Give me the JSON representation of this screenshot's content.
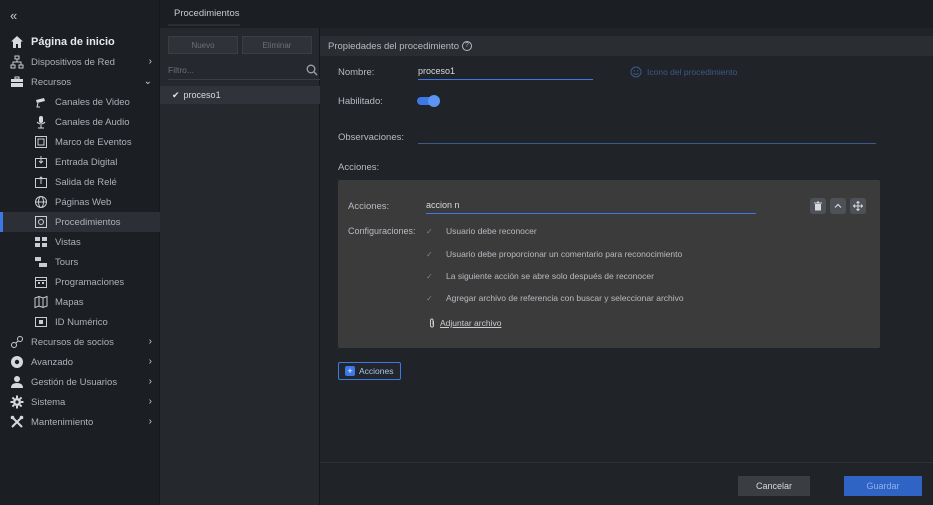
{
  "sidebar": {
    "collapse_icon": "double-chevron-left-icon",
    "items": [
      {
        "label": "Página de inicio",
        "icon": "home-icon"
      },
      {
        "label": "Dispositivos de Red",
        "icon": "network-icon"
      },
      {
        "label": "Recursos",
        "icon": "briefcase-icon"
      },
      {
        "label": "Canales de Video",
        "icon": "camera-icon"
      },
      {
        "label": "Canales de Audio",
        "icon": "microphone-icon"
      },
      {
        "label": "Marco de Eventos",
        "icon": "frame-icon"
      },
      {
        "label": "Entrada Digital",
        "icon": "input-icon"
      },
      {
        "label": "Salida de Relé",
        "icon": "output-icon"
      },
      {
        "label": "Páginas Web",
        "icon": "globe-icon"
      },
      {
        "label": "Procedimientos",
        "icon": "procedure-icon"
      },
      {
        "label": "Vistas",
        "icon": "views-icon"
      },
      {
        "label": "Tours",
        "icon": "tours-icon"
      },
      {
        "label": "Programaciones",
        "icon": "calendar-icon"
      },
      {
        "label": "Mapas",
        "icon": "map-icon"
      },
      {
        "label": "ID Numérico",
        "icon": "id-icon"
      },
      {
        "label": "Recursos de socios",
        "icon": "partner-icon"
      },
      {
        "label": "Avanzado",
        "icon": "advanced-icon"
      },
      {
        "label": "Gestión de Usuarios",
        "icon": "user-icon"
      },
      {
        "label": "Sistema",
        "icon": "gear-icon"
      },
      {
        "label": "Mantenimiento",
        "icon": "tools-icon"
      }
    ]
  },
  "topbar": {
    "tab": "Procedimientos"
  },
  "list": {
    "new_label": "Nuevo",
    "delete_label": "Eliminar",
    "filter_placeholder": "Filtro...",
    "items": [
      {
        "name": "proceso1",
        "checked": true
      }
    ]
  },
  "main": {
    "header": "Propiedades del procedimiento",
    "name_label": "Nombre:",
    "name_value": "proceso1",
    "icon_picker_label": "Icono del procedimiento",
    "enabled_label": "Habilitado:",
    "enabled": true,
    "observations_label": "Observaciones:",
    "observations_value": "",
    "actions_label": "Acciones:",
    "action_box": {
      "action_label": "Acciones:",
      "action_value": "accion n",
      "config_label": "Configuraciones:",
      "options": [
        "Usuario debe reconocer",
        "Usuario debe proporcionar un comentario para reconocimiento",
        "La siguiente acción se abre solo después de reconocer",
        "Agregar archivo de referencia con buscar y seleccionar archivo"
      ],
      "attach_label": "Adjuntar archivo"
    },
    "add_actions_label": "Acciones"
  },
  "footer": {
    "cancel_label": "Cancelar",
    "save_label": "Guardar"
  },
  "colors": {
    "accent": "#3c78e6",
    "sidebar_bg": "#1b1e22",
    "panel_bg": "#25282d",
    "action_box_bg": "#3b3b3b"
  }
}
